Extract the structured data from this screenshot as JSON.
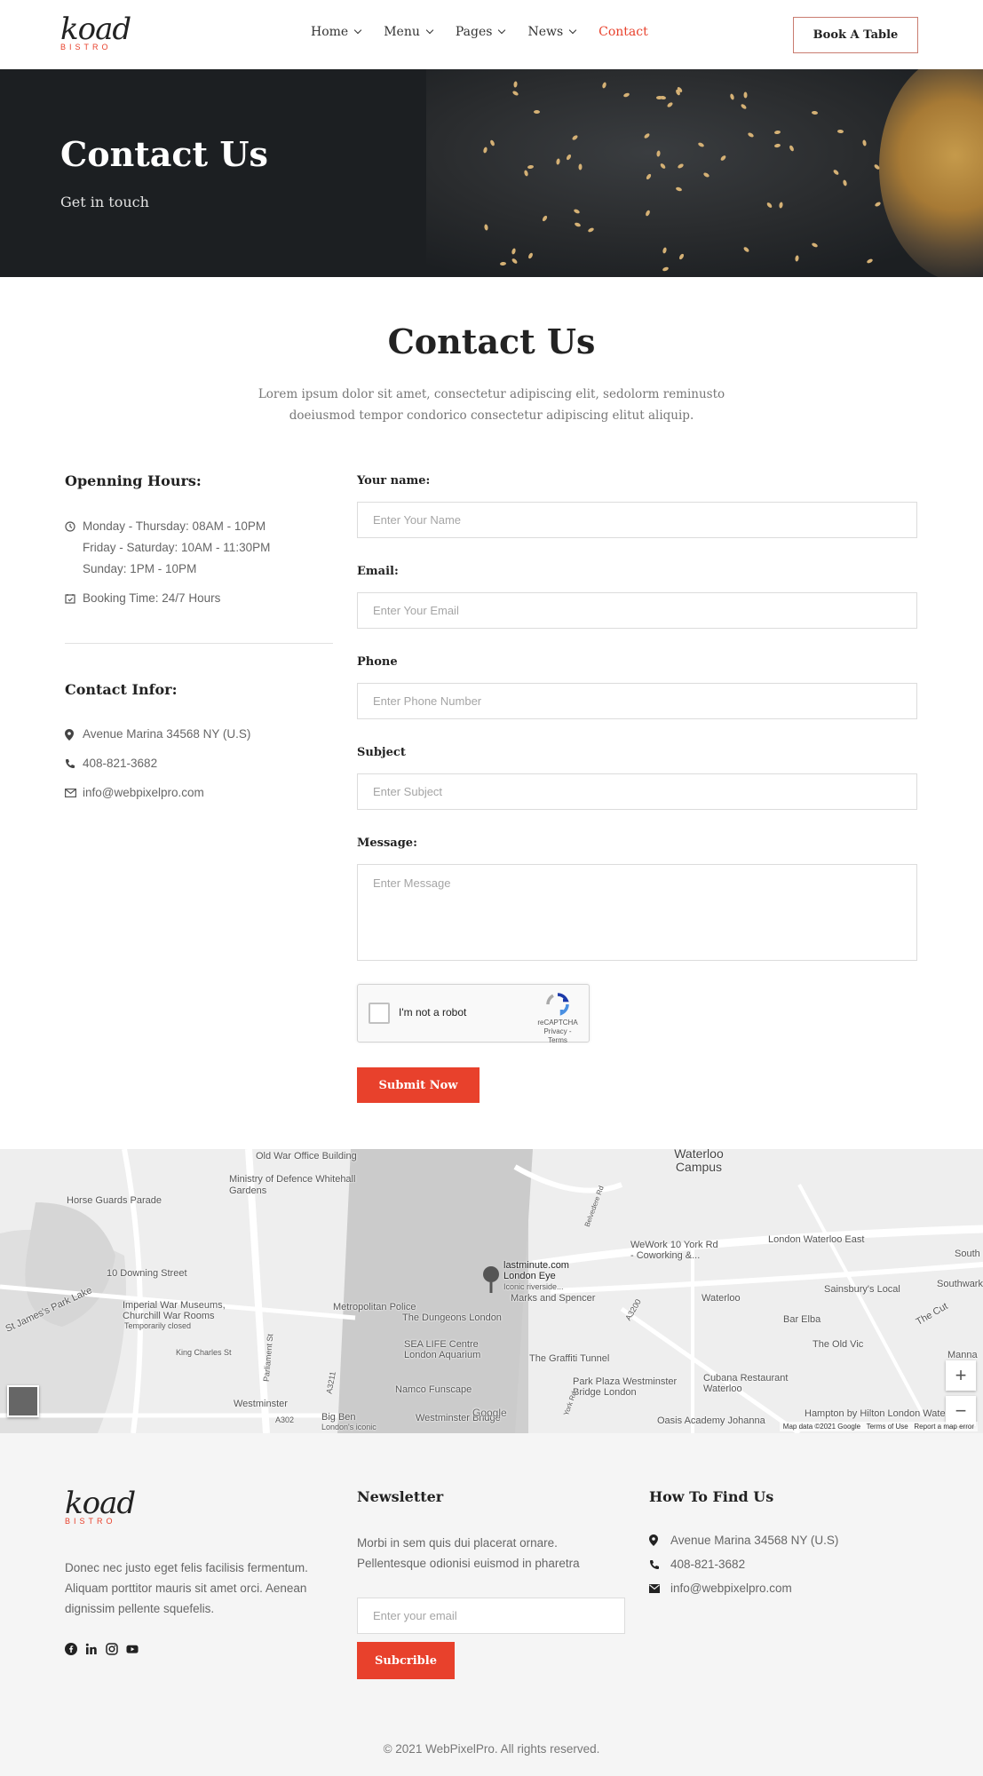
{
  "brand": {
    "logo_script": "koad",
    "logo_sub": "BISTRO"
  },
  "nav": {
    "items": [
      {
        "label": "Home",
        "dropdown": true,
        "active": false
      },
      {
        "label": "Menu",
        "dropdown": true,
        "active": false
      },
      {
        "label": "Pages",
        "dropdown": true,
        "active": false
      },
      {
        "label": "News",
        "dropdown": true,
        "active": false
      },
      {
        "label": "Contact",
        "dropdown": false,
        "active": true
      }
    ],
    "cta": "Book A Table"
  },
  "hero": {
    "title": "Contact Us",
    "subtitle": "Get in touch"
  },
  "section": {
    "title": "Contact Us",
    "description": "Lorem ipsum dolor sit amet, consectetur adipiscing elit, sedolorm reminusto doeiusmod tempor condorico consectetur adipiscing elitut aliquip."
  },
  "hours": {
    "heading": "Openning Hours:",
    "lines": [
      "Monday - Thursday: 08AM - 10PM",
      "Friday - Saturday: 10AM - 11:30PM",
      "Sunday: 1PM - 10PM"
    ],
    "booking": "Booking Time: 24/7 Hours"
  },
  "contact_info": {
    "heading": "Contact Infor:",
    "address": "Avenue Marina 34568 NY (U.S)",
    "phone": "408-821-3682",
    "email": "info@webpixelpro.com"
  },
  "form": {
    "name_label": "Your name:",
    "name_placeholder": "Enter Your Name",
    "email_label": "Email:",
    "email_placeholder": "Enter Your Email",
    "phone_label": "Phone",
    "phone_placeholder": "Enter Phone Number",
    "subject_label": "Subject",
    "subject_placeholder": "Enter Subject",
    "message_label": "Message:",
    "message_placeholder": "Enter Message",
    "captcha_label": "I'm not a robot",
    "captcha_brand": "reCAPTCHA",
    "captcha_links": "Privacy - Terms",
    "submit": "Submit Now"
  },
  "map": {
    "labels": [
      "Old War Office Building",
      "Ministry of Defence Whitehall Gardens",
      "Horse Guards Parade",
      "Waterloo Campus",
      "10 Downing Street",
      "St James's Park Lake",
      "Imperial War Museums, Churchill War Rooms",
      "Temporarily closed",
      "King Charles St",
      "Metropolitan Police",
      "lastminute.com London Eye",
      "Iconic riverside...",
      "Marks and Spencer",
      "The Dungeons London",
      "SEA LIFE Centre London Aquarium",
      "The Graffiti Tunnel",
      "Park Plaza Westminster Bridge London",
      "Namco Funscape",
      "Westminster",
      "Big Ben",
      "London's iconic",
      "Westminster Bridge",
      "WeWork 10 York Rd - Coworking &...",
      "London Waterloo East",
      "Sainsbury's Local",
      "Waterloo",
      "Bar Elba",
      "The Old Vic",
      "Cubana Restaurant Waterloo",
      "Oasis Academy Johanna",
      "Hampton by Hilton London Waterloo",
      "The Cut",
      "Southwark",
      "Manna",
      "South",
      "A3200",
      "A302",
      "A3211",
      "Parliament St",
      "Belvedere Rd",
      "York Rd"
    ],
    "footer": [
      "Map data ©2021 Google",
      "Terms of Use",
      "Report a map error"
    ],
    "google": "Google",
    "zoom_in": "+",
    "zoom_out": "−"
  },
  "footer": {
    "about": "Donec nec justo eget felis facilisis fermentum. Aliquam porttitor mauris sit amet orci. Aenean dignissim pellente squefelis.",
    "newsletter_heading": "Newsletter",
    "newsletter_text": "Morbi in sem quis dui placerat ornare. Pellentesque odionisi euismod in pharetra",
    "newsletter_placeholder": "Enter your email",
    "newsletter_button": "Subcrible",
    "find_heading": "How To Find Us",
    "address": "Avenue Marina 34568 NY (U.S)",
    "phone": "408-821-3682",
    "email": "info@webpixelpro.com",
    "copyright": "© 2021 WebPixelPro. All rights reserved.",
    "social": [
      "facebook-icon",
      "linkedin-icon",
      "instagram-icon",
      "youtube-icon"
    ]
  },
  "colors": {
    "accent": "#e8412c",
    "dark": "#222222",
    "hero_bg": "#1c1f22"
  }
}
